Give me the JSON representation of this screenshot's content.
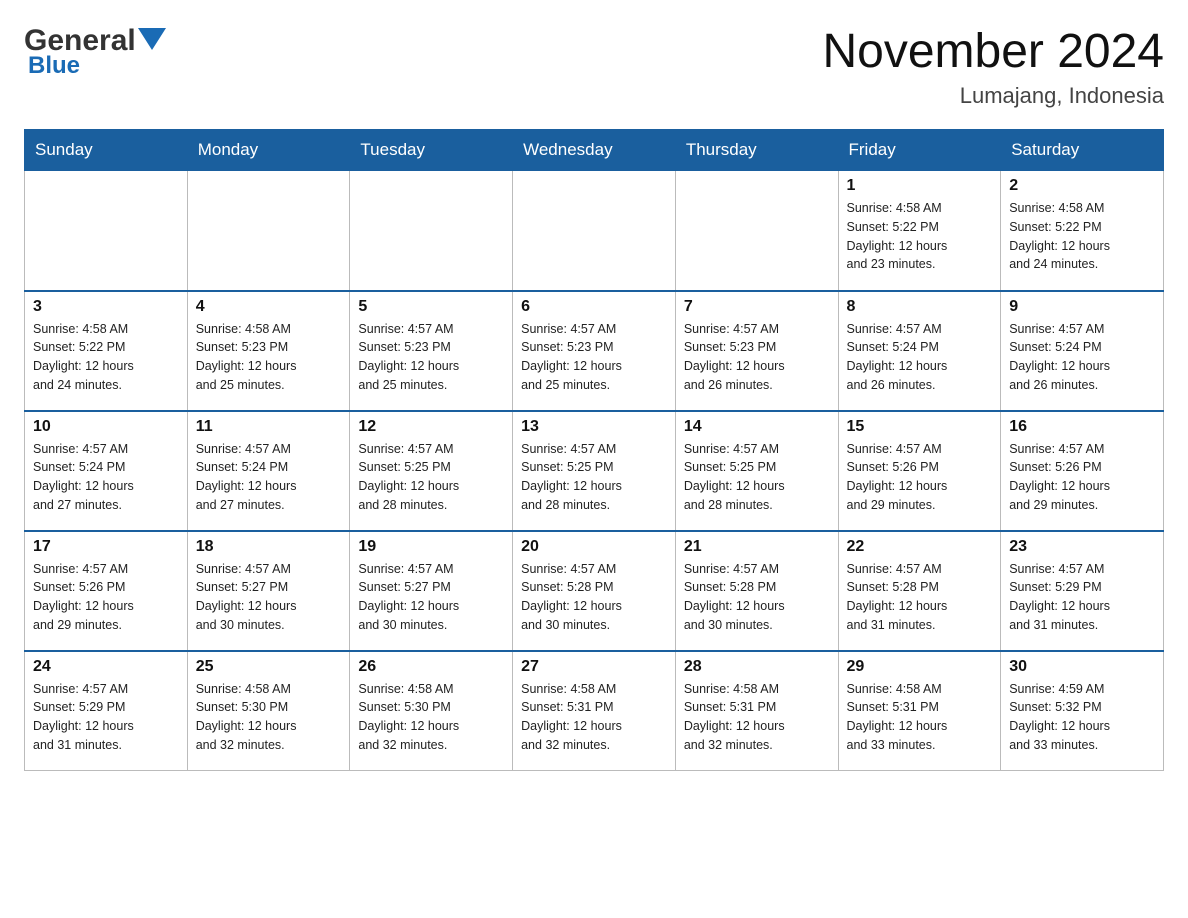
{
  "header": {
    "logo_general": "General",
    "logo_blue": "Blue",
    "month_year": "November 2024",
    "location": "Lumajang, Indonesia"
  },
  "days_of_week": [
    "Sunday",
    "Monday",
    "Tuesday",
    "Wednesday",
    "Thursday",
    "Friday",
    "Saturday"
  ],
  "weeks": [
    {
      "days": [
        {
          "num": "",
          "info": ""
        },
        {
          "num": "",
          "info": ""
        },
        {
          "num": "",
          "info": ""
        },
        {
          "num": "",
          "info": ""
        },
        {
          "num": "",
          "info": ""
        },
        {
          "num": "1",
          "info": "Sunrise: 4:58 AM\nSunset: 5:22 PM\nDaylight: 12 hours\nand 23 minutes."
        },
        {
          "num": "2",
          "info": "Sunrise: 4:58 AM\nSunset: 5:22 PM\nDaylight: 12 hours\nand 24 minutes."
        }
      ]
    },
    {
      "days": [
        {
          "num": "3",
          "info": "Sunrise: 4:58 AM\nSunset: 5:22 PM\nDaylight: 12 hours\nand 24 minutes."
        },
        {
          "num": "4",
          "info": "Sunrise: 4:58 AM\nSunset: 5:23 PM\nDaylight: 12 hours\nand 25 minutes."
        },
        {
          "num": "5",
          "info": "Sunrise: 4:57 AM\nSunset: 5:23 PM\nDaylight: 12 hours\nand 25 minutes."
        },
        {
          "num": "6",
          "info": "Sunrise: 4:57 AM\nSunset: 5:23 PM\nDaylight: 12 hours\nand 25 minutes."
        },
        {
          "num": "7",
          "info": "Sunrise: 4:57 AM\nSunset: 5:23 PM\nDaylight: 12 hours\nand 26 minutes."
        },
        {
          "num": "8",
          "info": "Sunrise: 4:57 AM\nSunset: 5:24 PM\nDaylight: 12 hours\nand 26 minutes."
        },
        {
          "num": "9",
          "info": "Sunrise: 4:57 AM\nSunset: 5:24 PM\nDaylight: 12 hours\nand 26 minutes."
        }
      ]
    },
    {
      "days": [
        {
          "num": "10",
          "info": "Sunrise: 4:57 AM\nSunset: 5:24 PM\nDaylight: 12 hours\nand 27 minutes."
        },
        {
          "num": "11",
          "info": "Sunrise: 4:57 AM\nSunset: 5:24 PM\nDaylight: 12 hours\nand 27 minutes."
        },
        {
          "num": "12",
          "info": "Sunrise: 4:57 AM\nSunset: 5:25 PM\nDaylight: 12 hours\nand 28 minutes."
        },
        {
          "num": "13",
          "info": "Sunrise: 4:57 AM\nSunset: 5:25 PM\nDaylight: 12 hours\nand 28 minutes."
        },
        {
          "num": "14",
          "info": "Sunrise: 4:57 AM\nSunset: 5:25 PM\nDaylight: 12 hours\nand 28 minutes."
        },
        {
          "num": "15",
          "info": "Sunrise: 4:57 AM\nSunset: 5:26 PM\nDaylight: 12 hours\nand 29 minutes."
        },
        {
          "num": "16",
          "info": "Sunrise: 4:57 AM\nSunset: 5:26 PM\nDaylight: 12 hours\nand 29 minutes."
        }
      ]
    },
    {
      "days": [
        {
          "num": "17",
          "info": "Sunrise: 4:57 AM\nSunset: 5:26 PM\nDaylight: 12 hours\nand 29 minutes."
        },
        {
          "num": "18",
          "info": "Sunrise: 4:57 AM\nSunset: 5:27 PM\nDaylight: 12 hours\nand 30 minutes."
        },
        {
          "num": "19",
          "info": "Sunrise: 4:57 AM\nSunset: 5:27 PM\nDaylight: 12 hours\nand 30 minutes."
        },
        {
          "num": "20",
          "info": "Sunrise: 4:57 AM\nSunset: 5:28 PM\nDaylight: 12 hours\nand 30 minutes."
        },
        {
          "num": "21",
          "info": "Sunrise: 4:57 AM\nSunset: 5:28 PM\nDaylight: 12 hours\nand 30 minutes."
        },
        {
          "num": "22",
          "info": "Sunrise: 4:57 AM\nSunset: 5:28 PM\nDaylight: 12 hours\nand 31 minutes."
        },
        {
          "num": "23",
          "info": "Sunrise: 4:57 AM\nSunset: 5:29 PM\nDaylight: 12 hours\nand 31 minutes."
        }
      ]
    },
    {
      "days": [
        {
          "num": "24",
          "info": "Sunrise: 4:57 AM\nSunset: 5:29 PM\nDaylight: 12 hours\nand 31 minutes."
        },
        {
          "num": "25",
          "info": "Sunrise: 4:58 AM\nSunset: 5:30 PM\nDaylight: 12 hours\nand 32 minutes."
        },
        {
          "num": "26",
          "info": "Sunrise: 4:58 AM\nSunset: 5:30 PM\nDaylight: 12 hours\nand 32 minutes."
        },
        {
          "num": "27",
          "info": "Sunrise: 4:58 AM\nSunset: 5:31 PM\nDaylight: 12 hours\nand 32 minutes."
        },
        {
          "num": "28",
          "info": "Sunrise: 4:58 AM\nSunset: 5:31 PM\nDaylight: 12 hours\nand 32 minutes."
        },
        {
          "num": "29",
          "info": "Sunrise: 4:58 AM\nSunset: 5:31 PM\nDaylight: 12 hours\nand 33 minutes."
        },
        {
          "num": "30",
          "info": "Sunrise: 4:59 AM\nSunset: 5:32 PM\nDaylight: 12 hours\nand 33 minutes."
        }
      ]
    }
  ]
}
